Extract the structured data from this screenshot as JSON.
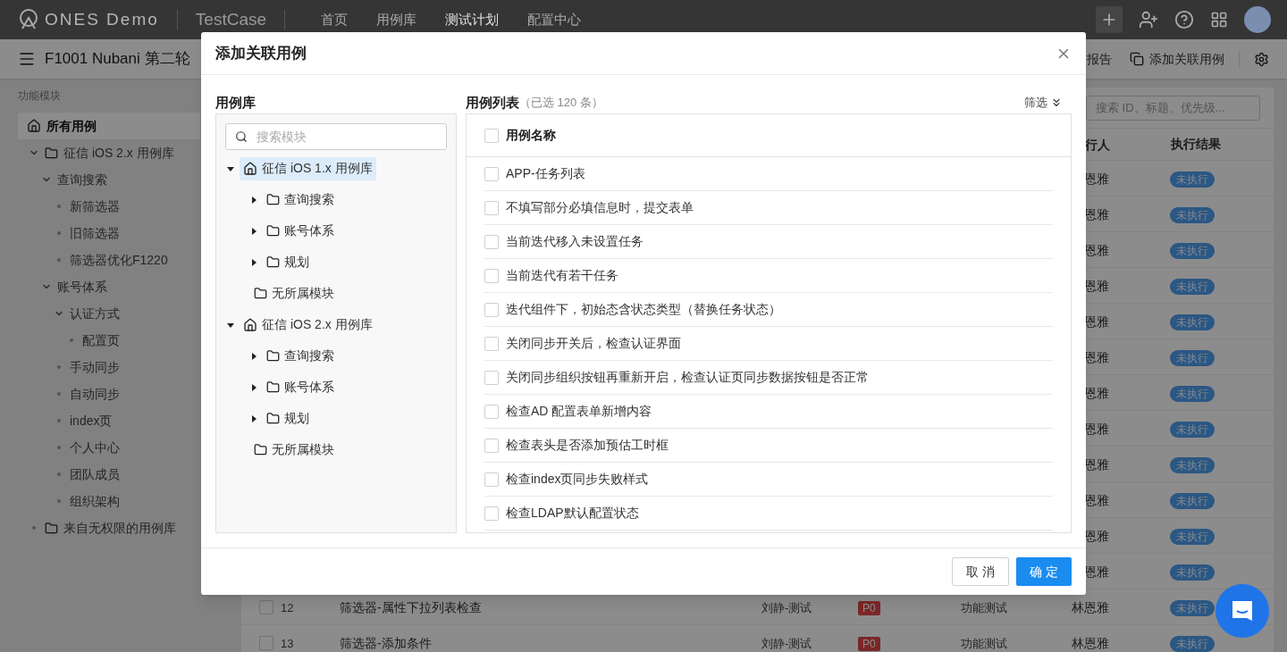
{
  "top_nav": {
    "logo": "ONES Demo",
    "product": "TestCase",
    "items": [
      {
        "label": "首页",
        "selected": false
      },
      {
        "label": "用例库",
        "selected": false
      },
      {
        "label": "测试计划",
        "selected": true
      },
      {
        "label": "配置中心",
        "selected": false
      }
    ]
  },
  "toolbar": {
    "title": "F1001 Nubani 第二轮",
    "report": "报告",
    "add_related": "添加关联用例"
  },
  "sidebar": {
    "label": "功能模块",
    "tree": [
      {
        "kind": "home",
        "label": "所有用例",
        "selected": true
      },
      {
        "kind": "folder",
        "label": "征信 iOS 2.x 用例库",
        "expanded": true,
        "selected": false,
        "children": [
          {
            "label": "查询搜索",
            "expanded": true,
            "selected": false,
            "children": [
              {
                "label": "新筛选器",
                "selected": false
              },
              {
                "label": "旧筛选器",
                "selected": false
              },
              {
                "label": "筛选器优化F1220",
                "selected": false
              }
            ]
          },
          {
            "label": "账号体系",
            "expanded": true,
            "selected": false,
            "children": [
              {
                "label": "认证方式",
                "expanded": true,
                "selected": false,
                "children": [
                  {
                    "label": "配置页",
                    "selected": false
                  }
                ]
              },
              {
                "label": "手动同步",
                "selected": false
              },
              {
                "label": "自动同步",
                "selected": false
              },
              {
                "label": "index页",
                "selected": false
              },
              {
                "label": "个人中心",
                "selected": false
              },
              {
                "label": "团队成员",
                "selected": false
              },
              {
                "label": "组织架构",
                "selected": false
              }
            ]
          }
        ]
      },
      {
        "kind": "folder",
        "label": "来自无权限的用例库",
        "selected": false
      }
    ]
  },
  "table": {
    "search_placeholder": "搜索 ID、标题、优先级...",
    "columns": [
      "行人",
      "执行结果"
    ],
    "rows": [
      {
        "column_6": "恩雅",
        "column_7": "未执行"
      },
      {
        "column_6": "恩雅",
        "column_7": "未执行"
      },
      {
        "column_6": "恩雅",
        "column_7": "未执行"
      },
      {
        "column_6": "恩雅",
        "column_7": "未执行"
      },
      {
        "column_6": "恩雅",
        "column_7": "未执行"
      },
      {
        "column_6": "恩雅",
        "column_7": "未执行"
      },
      {
        "column_6": "恩雅",
        "column_7": "未执行"
      },
      {
        "column_6": "恩雅",
        "column_7": "未执行"
      },
      {
        "column_6": "恩雅",
        "column_7": "未执行"
      },
      {
        "column_6": "恩雅",
        "column_7": "未执行"
      },
      {
        "column_6": "恩雅",
        "column_7": "未执行"
      },
      {
        "column_6": "恩雅",
        "column_7": "未执行"
      },
      {
        "checked": false,
        "column_1": "12",
        "column_2": "筛选器-属性下拉列表检查",
        "column_3": "刘静-测试",
        "column_4": "P0",
        "column_5": "功能测试",
        "column_6": "林恩雅",
        "column_7": "未执行"
      },
      {
        "checked": false,
        "column_1": "13",
        "column_2": "筛选器-添加条件",
        "column_3": "刘静-测试",
        "column_4": "P0",
        "column_5": "功能测试",
        "column_6": "林恩雅",
        "column_7": "未执行"
      }
    ]
  },
  "dialog": {
    "title": "添加关联用例",
    "library_label": "用例库",
    "search_placeholder": "搜索模块",
    "tree": [
      {
        "kind": "library",
        "label": "征信 iOS 1.x 用例库",
        "expanded": true,
        "selected": true,
        "children": [
          {
            "kind": "folder",
            "label": "查询搜索",
            "expanded": false,
            "selected": false
          },
          {
            "kind": "folder",
            "label": "账号体系",
            "expanded": false,
            "selected": false
          },
          {
            "kind": "folder",
            "label": "规划",
            "expanded": false,
            "selected": false
          },
          {
            "kind": "folder",
            "label": "无所属模块",
            "selected": false
          }
        ]
      },
      {
        "kind": "library",
        "label": "征信 iOS 2.x 用例库",
        "expanded": true,
        "selected": false,
        "children": [
          {
            "kind": "folder",
            "label": "查询搜索",
            "expanded": false,
            "selected": false
          },
          {
            "kind": "folder",
            "label": "账号体系",
            "expanded": false,
            "selected": false
          },
          {
            "kind": "folder",
            "label": "规划",
            "expanded": false,
            "selected": false
          },
          {
            "kind": "folder",
            "label": "无所属模块",
            "selected": false
          }
        ]
      }
    ],
    "list_title": "用例列表",
    "list_count": "（已选 120 条）",
    "filter": "筛选",
    "header": {
      "label": "用例名称",
      "checked": false
    },
    "cases": [
      {
        "name": "APP-任务列表",
        "checked": false
      },
      {
        "name": "不填写部分必填信息时，提交表单",
        "checked": false
      },
      {
        "name": "当前迭代移入未设置任务",
        "checked": false
      },
      {
        "name": "当前迭代有若干任务",
        "checked": false
      },
      {
        "name": "迭代组件下，初始态含状态类型（替换任务状态）",
        "checked": false
      },
      {
        "name": "关闭同步开关后，检查认证界面",
        "checked": false
      },
      {
        "name": "关闭同步组织按钮再重新开启，检查认证页同步数据按钮是否正常",
        "checked": false
      },
      {
        "name": "检查AD 配置表单新增内容",
        "checked": false
      },
      {
        "name": "检查表头是否添加预估工时框",
        "checked": false
      },
      {
        "name": "检查index页同步失败样式",
        "checked": false
      },
      {
        "name": "检查LDAP默认配置状态",
        "checked": false
      }
    ],
    "cancel": "取 消",
    "ok": "确 定"
  }
}
